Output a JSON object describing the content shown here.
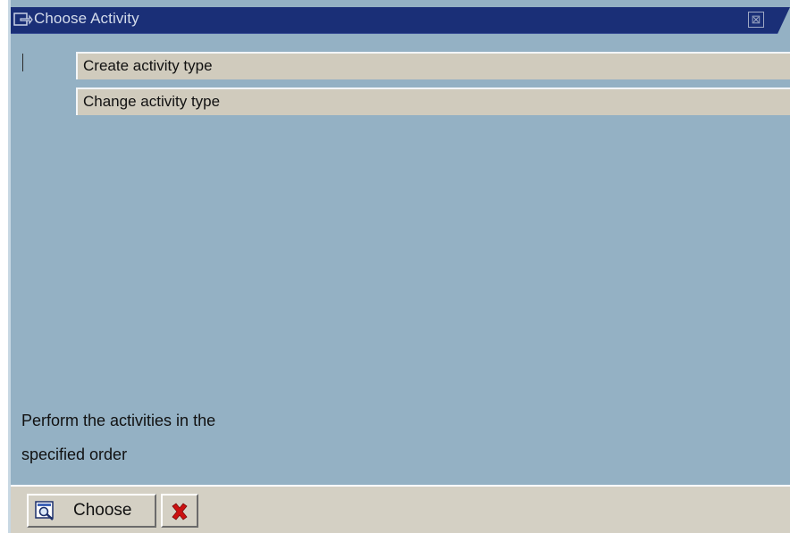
{
  "window": {
    "title": "Choose Activity",
    "close_glyph": "⊠"
  },
  "activities": [
    {
      "label": "Create activity type"
    },
    {
      "label": "Change activity type"
    }
  ],
  "hint": {
    "line1": "Perform the activities in the",
    "line2": "specified order"
  },
  "footer": {
    "choose_label": "Choose",
    "choose_icon": "choose-icon",
    "cancel_icon": "cancel-icon"
  },
  "colors": {
    "titlebar": "#1a2f77",
    "background": "#94b1c4",
    "activity_bg": "#d0cbbd",
    "footer_bg": "#d4d0c4",
    "cancel_red": "#cc1111"
  }
}
